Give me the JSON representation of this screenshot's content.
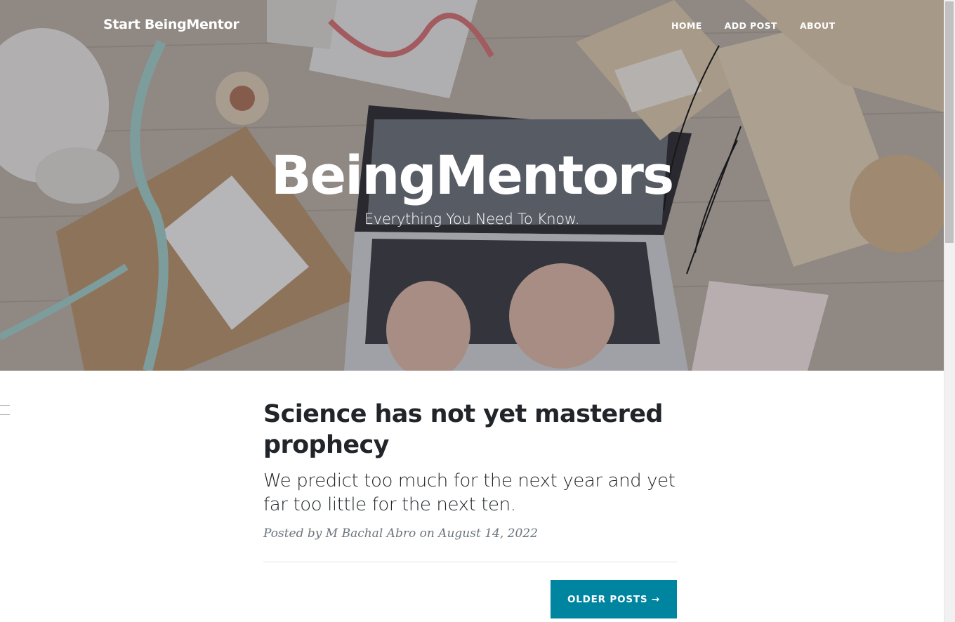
{
  "navbar": {
    "brand": "Start BeingMentor",
    "links": [
      "HOME",
      "ADD POST",
      "ABOUT"
    ]
  },
  "header": {
    "title": "BeingMentors",
    "subtitle": "Everything You Need To Know."
  },
  "post": {
    "title": "Science has not yet mastered prophecy",
    "subtitle": "We predict too much for the next year and yet far too little for the next ten.",
    "meta": "Posted by M Bachal Abro on August 14, 2022"
  },
  "pager": {
    "older_label": "OLDER POSTS →"
  },
  "colors": {
    "accent": "#0085a1",
    "text": "#212529",
    "meta": "#6c757d"
  }
}
